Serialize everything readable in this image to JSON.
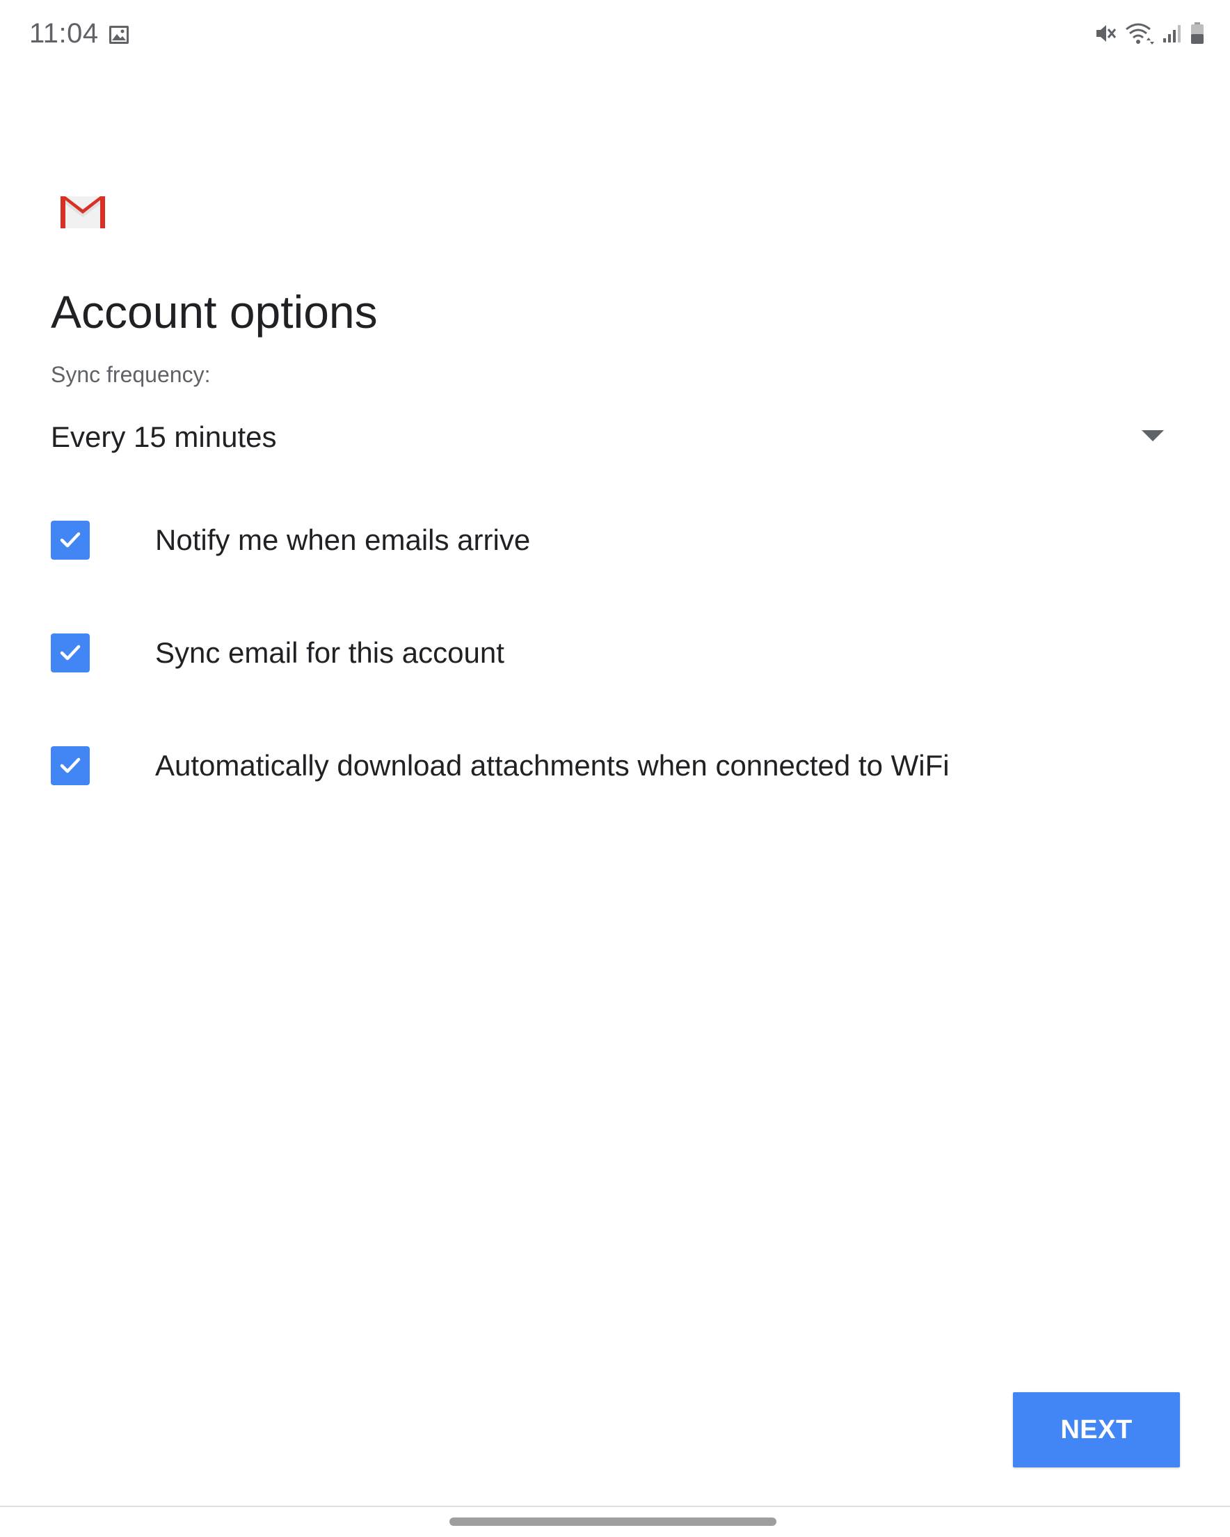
{
  "status_bar": {
    "time": "11:04",
    "left_icons": [
      "gallery-icon"
    ],
    "right_icons": [
      "mute-icon",
      "wifi-icon",
      "signal-icon",
      "battery-icon"
    ]
  },
  "app": {
    "logo": "gmail-icon",
    "brand_colors": {
      "gmail_red": "#d93025",
      "accent_blue": "#4285f4"
    }
  },
  "page": {
    "title": "Account options",
    "sync_label": "Sync frequency:",
    "sync_value": "Every 15 minutes"
  },
  "options": [
    {
      "label": "Notify me when emails arrive",
      "checked": true
    },
    {
      "label": "Sync email for this account",
      "checked": true
    },
    {
      "label": "Automatically download attachments when connected to WiFi",
      "checked": true
    }
  ],
  "actions": {
    "next_label": "NEXT"
  }
}
